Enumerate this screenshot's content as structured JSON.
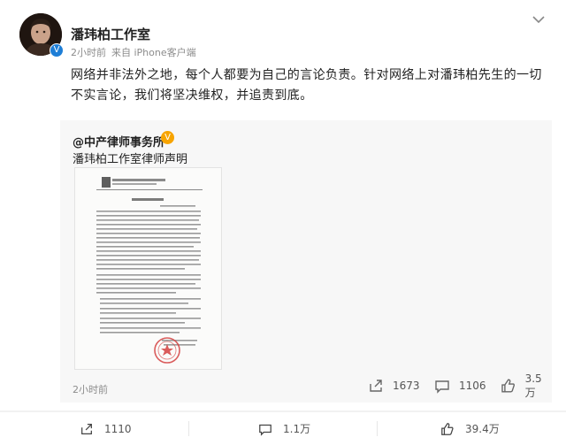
{
  "post": {
    "author_name": "潘玮柏工作室",
    "time": "2小时前",
    "source": "来自 iPhone客户端",
    "text": "网络并非法外之地，每个人都要为自己的言论负责。针对网络上对潘玮柏先生的一切不实言论，我们将坚决维权，并追责到底。"
  },
  "repost": {
    "author": "@中产律师事务所",
    "text": "潘玮柏工作室律师声明",
    "time": "2小时前",
    "actions": {
      "share_count": "1673",
      "comment_count": "1106",
      "like_count": "3.5万"
    },
    "document": {
      "firm_cn": "北京市中产律师事务所",
      "firm_en": "Beijing Zhongchan Law Firm",
      "title": "律师声明"
    }
  },
  "footer": {
    "share_count": "1110",
    "comment_count": "1.1万",
    "like_count": "39.4万"
  },
  "colors": {
    "link_blue": "#1e7ed6",
    "verified_gold": "#f7a400",
    "seal_red": "#d43f3f"
  }
}
